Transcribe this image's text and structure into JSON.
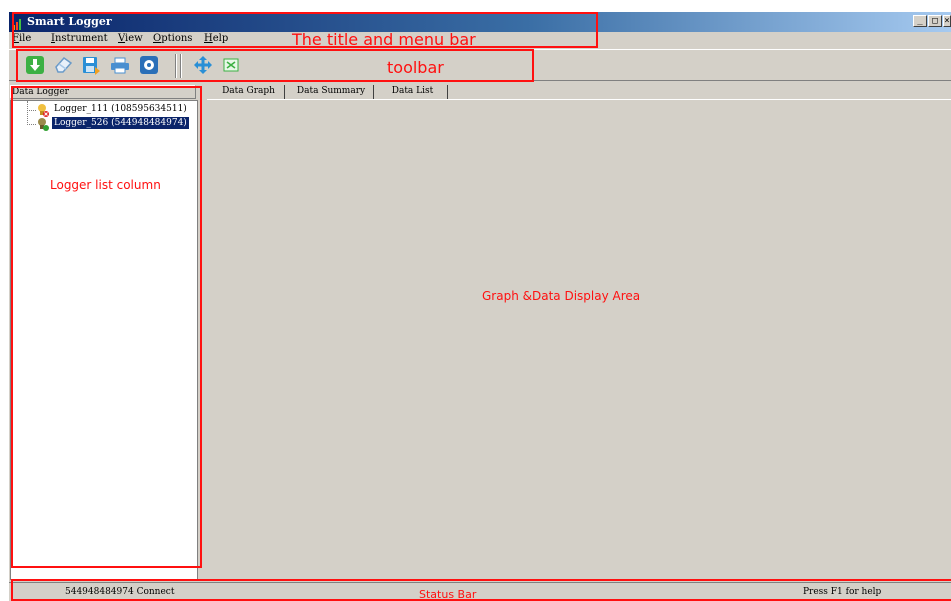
{
  "window": {
    "title": "Smart Logger",
    "controls": {
      "minimize": "_",
      "maximize": "□",
      "close": "×"
    }
  },
  "menu": {
    "items": [
      {
        "accel": "F",
        "rest": "ile"
      },
      {
        "accel": "I",
        "rest": "nstrument"
      },
      {
        "accel": "V",
        "rest": "iew"
      },
      {
        "accel": "O",
        "rest": "ptions"
      },
      {
        "accel": "H",
        "rest": "elp"
      }
    ]
  },
  "toolbar": {
    "buttons": [
      {
        "icon": "download-icon",
        "color": "#3cb043"
      },
      {
        "icon": "eraser-icon",
        "color": "#a8c8e8"
      },
      {
        "icon": "save-icon",
        "color": "#2a8fd6"
      },
      {
        "icon": "print-icon",
        "color": "#4a8fd0"
      },
      {
        "icon": "settings-icon",
        "color": "#2a6fb8"
      },
      {
        "icon": "move-icon",
        "color": "#2a8fd6"
      },
      {
        "icon": "fit-icon",
        "color": "#3cb043"
      }
    ]
  },
  "logger_panel": {
    "header": "Data Logger",
    "items": [
      {
        "label": "Logger_111 (108595634511)",
        "icon": "logger-disconnected-icon",
        "selected": false
      },
      {
        "label": "Logger_526 (544948484974)",
        "icon": "logger-connected-icon",
        "selected": true
      }
    ]
  },
  "tabs": [
    "Data Graph",
    "Data Summary",
    "Data List"
  ],
  "status_bar": {
    "left": "544948484974 Connect",
    "right": "Press F1 for help"
  },
  "annotations": {
    "title_menu": "The title and menu bar",
    "toolbar": "toolbar",
    "logger_list": "Logger list column",
    "display_area": "Graph &Data Display Area",
    "status_bar": "Status Bar"
  },
  "colors": {
    "annotation": "#ff1010",
    "title_bar": "#0a246a",
    "selection": "#0a246a",
    "window_face": "#d4d0c8"
  }
}
